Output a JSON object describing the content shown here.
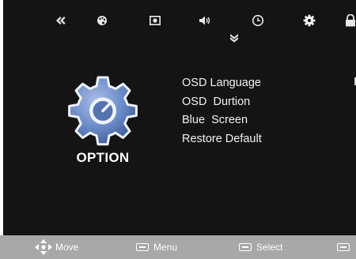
{
  "colors": {
    "osd_background": "#151314",
    "footer_background": "#a9a7a8",
    "text": "#ffffff",
    "gear_fill": "#5d7ebb"
  },
  "top_tabs": [
    {
      "icon": "double-chevron-left-icon",
      "selected": false
    },
    {
      "icon": "palette-icon",
      "selected": false
    },
    {
      "icon": "picture-icon",
      "selected": false
    },
    {
      "icon": "speaker-icon",
      "selected": false
    },
    {
      "icon": "clock-icon",
      "selected": false
    },
    {
      "icon": "gear-icon",
      "selected": true
    },
    {
      "icon": "lock-icon",
      "selected": false
    }
  ],
  "section": {
    "title": "OPTION",
    "icon": "gear-icon"
  },
  "menu": {
    "items": [
      "OSD Language",
      "OSD  Durtion",
      "Blue  Screen",
      "Restore Default"
    ]
  },
  "footer": {
    "move_label": "Move",
    "menu_label": "Menu",
    "select_label": "Select"
  }
}
